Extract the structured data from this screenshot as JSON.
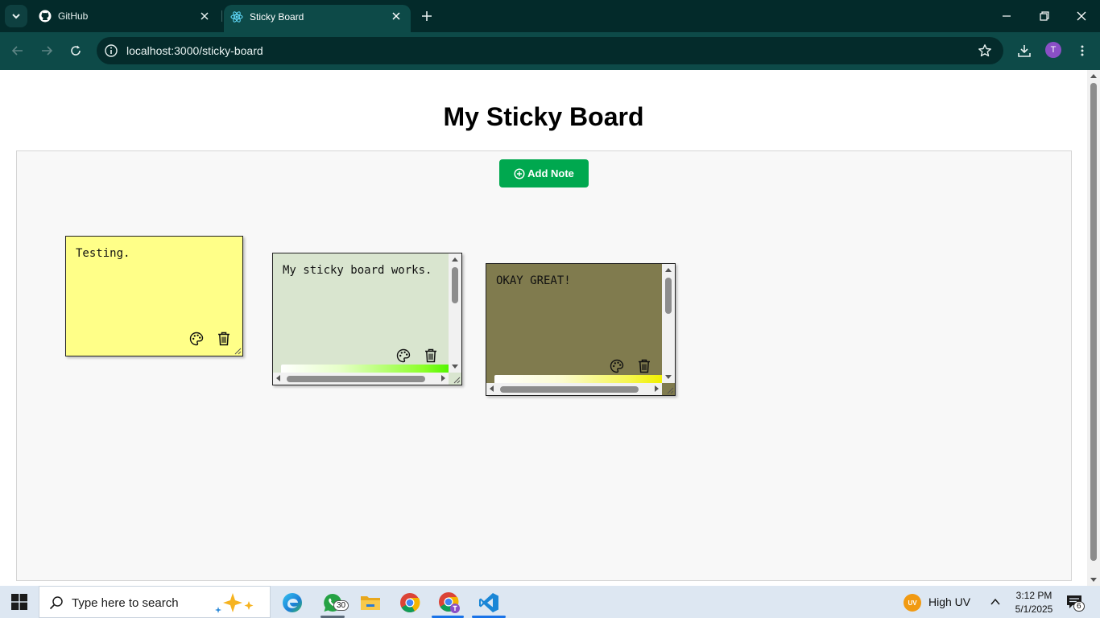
{
  "browser": {
    "tabs": [
      {
        "title": "GitHub",
        "icon": "github-icon"
      },
      {
        "title": "Sticky Board",
        "icon": "react-icon",
        "active": true
      }
    ],
    "url": "localhost:3000/sticky-board",
    "profile_initial": "T"
  },
  "page": {
    "title": "My Sticky Board",
    "add_button": "Add Note"
  },
  "notes": [
    {
      "text": "Testing.",
      "color": "#ffff88"
    },
    {
      "text": "My sticky board works.",
      "color": "#d9e5cf"
    },
    {
      "text": "OKAY GREAT!",
      "color": "#807b4e"
    }
  ],
  "taskbar": {
    "search_placeholder": "Type here to search",
    "whatsapp_badge": "30",
    "weather": "High UV",
    "weather_icon_text": "UV",
    "time": "3:12 PM",
    "date": "5/1/2025",
    "notification_count": "6"
  }
}
